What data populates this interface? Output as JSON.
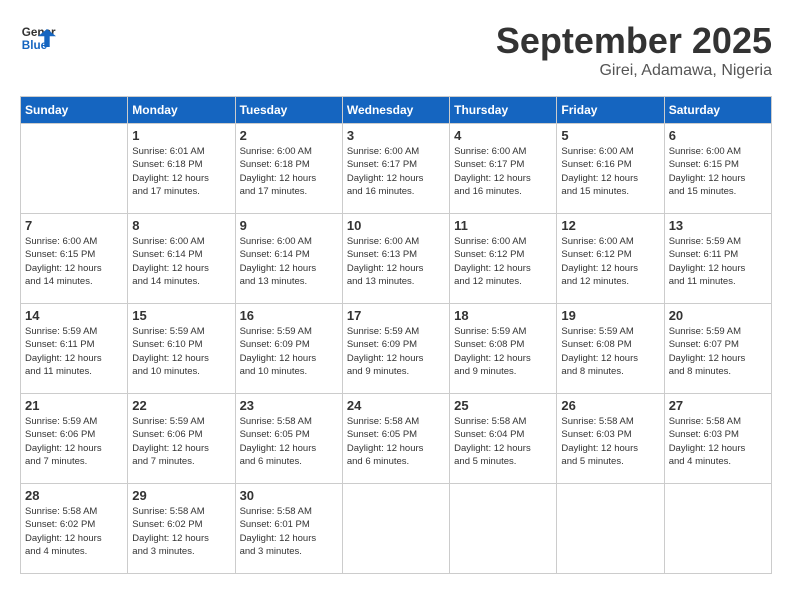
{
  "logo": {
    "line1": "General",
    "line2": "Blue"
  },
  "title": "September 2025",
  "subtitle": "Girei, Adamawa, Nigeria",
  "days": [
    "Sunday",
    "Monday",
    "Tuesday",
    "Wednesday",
    "Thursday",
    "Friday",
    "Saturday"
  ],
  "weeks": [
    [
      {
        "day": "",
        "info": ""
      },
      {
        "day": "1",
        "info": "Sunrise: 6:01 AM\nSunset: 6:18 PM\nDaylight: 12 hours\nand 17 minutes."
      },
      {
        "day": "2",
        "info": "Sunrise: 6:00 AM\nSunset: 6:18 PM\nDaylight: 12 hours\nand 17 minutes."
      },
      {
        "day": "3",
        "info": "Sunrise: 6:00 AM\nSunset: 6:17 PM\nDaylight: 12 hours\nand 16 minutes."
      },
      {
        "day": "4",
        "info": "Sunrise: 6:00 AM\nSunset: 6:17 PM\nDaylight: 12 hours\nand 16 minutes."
      },
      {
        "day": "5",
        "info": "Sunrise: 6:00 AM\nSunset: 6:16 PM\nDaylight: 12 hours\nand 15 minutes."
      },
      {
        "day": "6",
        "info": "Sunrise: 6:00 AM\nSunset: 6:15 PM\nDaylight: 12 hours\nand 15 minutes."
      }
    ],
    [
      {
        "day": "7",
        "info": "Sunrise: 6:00 AM\nSunset: 6:15 PM\nDaylight: 12 hours\nand 14 minutes."
      },
      {
        "day": "8",
        "info": "Sunrise: 6:00 AM\nSunset: 6:14 PM\nDaylight: 12 hours\nand 14 minutes."
      },
      {
        "day": "9",
        "info": "Sunrise: 6:00 AM\nSunset: 6:14 PM\nDaylight: 12 hours\nand 13 minutes."
      },
      {
        "day": "10",
        "info": "Sunrise: 6:00 AM\nSunset: 6:13 PM\nDaylight: 12 hours\nand 13 minutes."
      },
      {
        "day": "11",
        "info": "Sunrise: 6:00 AM\nSunset: 6:12 PM\nDaylight: 12 hours\nand 12 minutes."
      },
      {
        "day": "12",
        "info": "Sunrise: 6:00 AM\nSunset: 6:12 PM\nDaylight: 12 hours\nand 12 minutes."
      },
      {
        "day": "13",
        "info": "Sunrise: 5:59 AM\nSunset: 6:11 PM\nDaylight: 12 hours\nand 11 minutes."
      }
    ],
    [
      {
        "day": "14",
        "info": "Sunrise: 5:59 AM\nSunset: 6:11 PM\nDaylight: 12 hours\nand 11 minutes."
      },
      {
        "day": "15",
        "info": "Sunrise: 5:59 AM\nSunset: 6:10 PM\nDaylight: 12 hours\nand 10 minutes."
      },
      {
        "day": "16",
        "info": "Sunrise: 5:59 AM\nSunset: 6:09 PM\nDaylight: 12 hours\nand 10 minutes."
      },
      {
        "day": "17",
        "info": "Sunrise: 5:59 AM\nSunset: 6:09 PM\nDaylight: 12 hours\nand 9 minutes."
      },
      {
        "day": "18",
        "info": "Sunrise: 5:59 AM\nSunset: 6:08 PM\nDaylight: 12 hours\nand 9 minutes."
      },
      {
        "day": "19",
        "info": "Sunrise: 5:59 AM\nSunset: 6:08 PM\nDaylight: 12 hours\nand 8 minutes."
      },
      {
        "day": "20",
        "info": "Sunrise: 5:59 AM\nSunset: 6:07 PM\nDaylight: 12 hours\nand 8 minutes."
      }
    ],
    [
      {
        "day": "21",
        "info": "Sunrise: 5:59 AM\nSunset: 6:06 PM\nDaylight: 12 hours\nand 7 minutes."
      },
      {
        "day": "22",
        "info": "Sunrise: 5:59 AM\nSunset: 6:06 PM\nDaylight: 12 hours\nand 7 minutes."
      },
      {
        "day": "23",
        "info": "Sunrise: 5:58 AM\nSunset: 6:05 PM\nDaylight: 12 hours\nand 6 minutes."
      },
      {
        "day": "24",
        "info": "Sunrise: 5:58 AM\nSunset: 6:05 PM\nDaylight: 12 hours\nand 6 minutes."
      },
      {
        "day": "25",
        "info": "Sunrise: 5:58 AM\nSunset: 6:04 PM\nDaylight: 12 hours\nand 5 minutes."
      },
      {
        "day": "26",
        "info": "Sunrise: 5:58 AM\nSunset: 6:03 PM\nDaylight: 12 hours\nand 5 minutes."
      },
      {
        "day": "27",
        "info": "Sunrise: 5:58 AM\nSunset: 6:03 PM\nDaylight: 12 hours\nand 4 minutes."
      }
    ],
    [
      {
        "day": "28",
        "info": "Sunrise: 5:58 AM\nSunset: 6:02 PM\nDaylight: 12 hours\nand 4 minutes."
      },
      {
        "day": "29",
        "info": "Sunrise: 5:58 AM\nSunset: 6:02 PM\nDaylight: 12 hours\nand 3 minutes."
      },
      {
        "day": "30",
        "info": "Sunrise: 5:58 AM\nSunset: 6:01 PM\nDaylight: 12 hours\nand 3 minutes."
      },
      {
        "day": "",
        "info": ""
      },
      {
        "day": "",
        "info": ""
      },
      {
        "day": "",
        "info": ""
      },
      {
        "day": "",
        "info": ""
      }
    ]
  ]
}
